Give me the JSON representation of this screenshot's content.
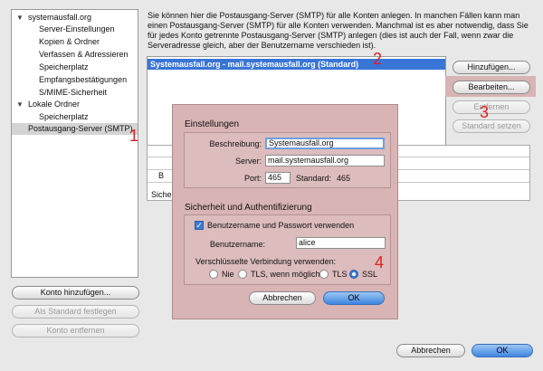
{
  "sidebar": {
    "items": [
      {
        "label": "systemausfall.org"
      },
      {
        "label": "Server-Einstellungen"
      },
      {
        "label": "Kopien & Ordner"
      },
      {
        "label": "Verfassen & Adressieren"
      },
      {
        "label": "Speicherplatz"
      },
      {
        "label": "Empfangsbestätigungen"
      },
      {
        "label": "S/MIME-Sicherheit"
      },
      {
        "label": "Lokale Ordner"
      },
      {
        "label": "Speicherplatz"
      },
      {
        "label": "Postausgang-Server (SMTP)"
      }
    ],
    "buttons": {
      "add_account": "Konto hinzufügen...",
      "set_default": "Als Standard festlegen",
      "remove_account": "Konto entfernen"
    }
  },
  "main": {
    "intro": "Sie können hier die Postausgang-Server (SMTP) für alle Konten anlegen. In manchen Fällen kann man einen Postausgang-Server (SMTP) für alle Konten verwenden. Manchmal ist es aber notwendig, dass Sie für jedes Konto getrennte Postausgang-Server (SMTP) anlegen (dies ist auch der Fall, wenn zwar die Serveradresse gleich, aber der Benutzername verschieden ist).",
    "server_list": [
      "Systemausfall.org - mail.systemausfall.org (Standard)"
    ],
    "buttons": {
      "add": "Hinzufügen...",
      "edit": "Bearbeiten...",
      "remove": "Entfernen",
      "set_default": "Standard setzen"
    },
    "detail_labels": [
      "B",
      "Sicher"
    ]
  },
  "dialog": {
    "settings_title": "Einstellungen",
    "description_label": "Beschreibung:",
    "description_value": "Systemausfall.org",
    "server_label": "Server:",
    "server_value": "mail.systemausfall.org",
    "port_label": "Port:",
    "port_value": "465",
    "standard_label": "Standard:",
    "standard_value": "465",
    "security_title": "Sicherheit und Authentifizierung",
    "use_auth_label": "Benutzername und Passwort verwenden",
    "username_label": "Benutzername:",
    "username_value": "alice",
    "encryption_label": "Verschlüsselte Verbindung verwenden:",
    "encryption_options": [
      "Nie",
      "TLS, wenn möglich",
      "TLS",
      "SSL"
    ],
    "encryption_selected": "SSL",
    "cancel": "Abbrechen",
    "ok": "OK"
  },
  "footer": {
    "cancel": "Abbrechen",
    "ok": "OK"
  },
  "markers": [
    "1",
    "2",
    "3",
    "4"
  ],
  "colors": {
    "selection": "#3875d7",
    "dialog_bg": "#d8b4b4",
    "marker": "#e02020",
    "ok_button": "#3e86df"
  }
}
